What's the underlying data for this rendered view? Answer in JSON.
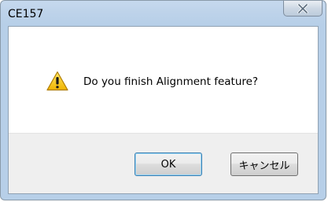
{
  "window": {
    "title": "CE157"
  },
  "dialog": {
    "message": "Do you finish Alignment feature?",
    "icon": "warning-icon"
  },
  "buttons": {
    "ok_label": "OK",
    "cancel_label": "キャンセル"
  },
  "colors": {
    "titlebar": "#bed3ea",
    "footer": "#efefef",
    "warning_fill": "#f5c400"
  }
}
